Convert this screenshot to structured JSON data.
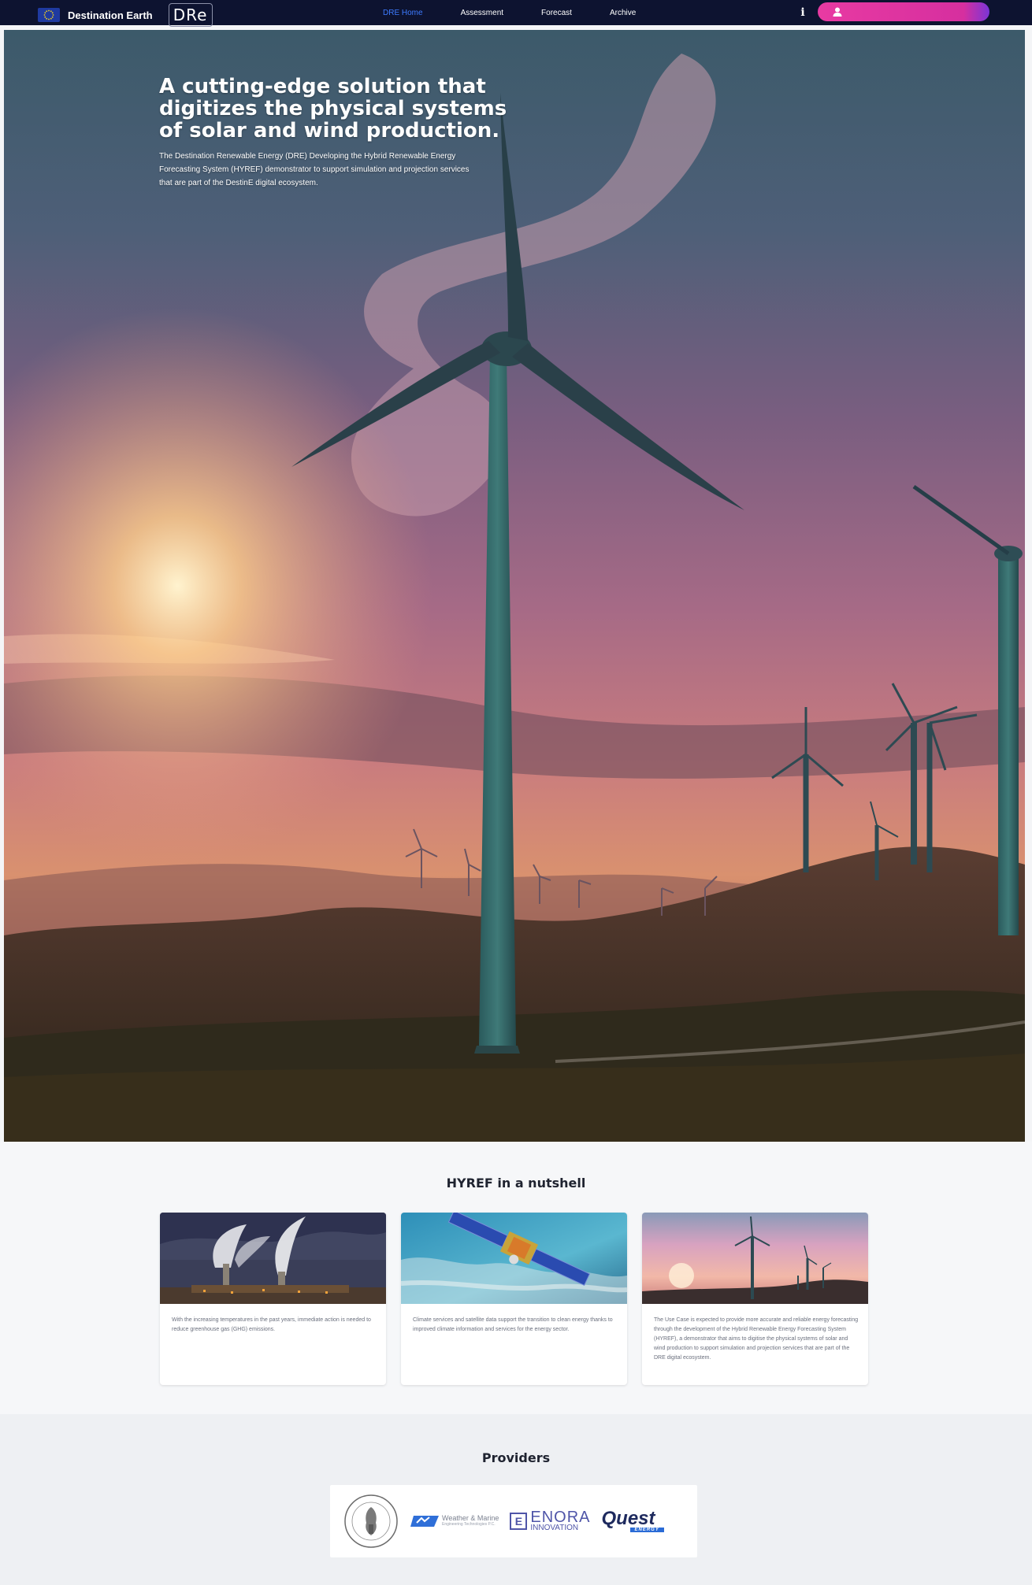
{
  "header": {
    "brand_name": "Destination Earth",
    "dre_logo": "DRe",
    "nav": [
      {
        "label": "DRE Home",
        "active": true
      },
      {
        "label": "Assessment",
        "active": false
      },
      {
        "label": "Forecast",
        "active": false
      },
      {
        "label": "Archive",
        "active": false
      }
    ],
    "info_label": "i",
    "icons": {
      "flag": "eu-flag-icon",
      "user": "user-icon",
      "info": "info-icon"
    },
    "colors": {
      "bar": "#0d1330",
      "active_link": "#3d7bff",
      "user_button": "#e83aa2"
    }
  },
  "hero": {
    "title": "A cutting-edge solution that digitizes the physical systems of solar and wind production.",
    "description": "The Destination Renewable Energy (DRE) Developing the Hybrid Renewable Energy Forecasting System (HYREF) demonstrator to support simulation and projection services that are part of the DestinE digital ecosystem."
  },
  "nutshell": {
    "title": "HYREF in a nutshell",
    "cards": [
      {
        "image": "industrial-chimneys-smoke",
        "text": "With the increasing temperatures in the past years, immediate action is needed to reduce greenhouse gas (GHG) emissions."
      },
      {
        "image": "satellite-over-earth",
        "text": "Climate services and satellite data support the transition to clean energy thanks to improved climate information and services for the energy sector."
      },
      {
        "image": "wind-turbines-sunset",
        "text": "The Use Case is expected to provide more accurate and reliable energy forecasting through the development of the Hybrid Renewable Energy Forecasting System (HYREF), a demonstrator that aims to digitise the physical systems of solar and wind production to support simulation and projection services that are part of the DRE digital ecosystem."
      }
    ]
  },
  "providers": {
    "title": "Providers",
    "logos": {
      "seal": "university-seal-logo",
      "weather_marine": {
        "main": "Weather & Marine",
        "sub": "Engineering Technologies P.C."
      },
      "enora": {
        "main": "ENORA",
        "sub": "INNOVATION"
      },
      "quest": {
        "main": "Quest",
        "sub": "ENERGY"
      }
    }
  }
}
